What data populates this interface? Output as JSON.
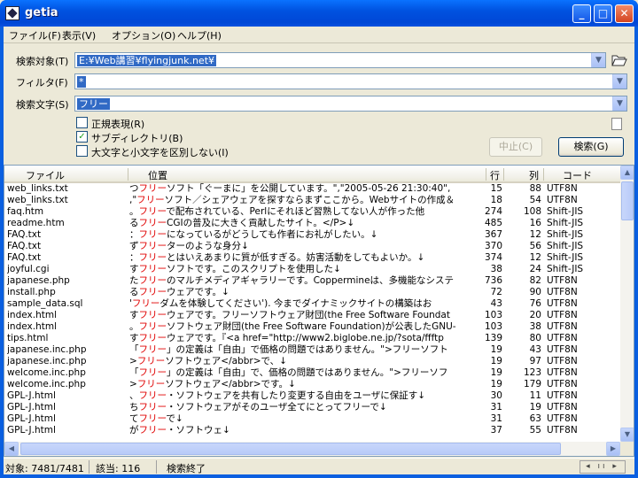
{
  "window": {
    "title": "getia",
    "min_glyph": "_",
    "max_glyph": "□",
    "close_glyph": "✕"
  },
  "menu": {
    "items": [
      "ファイル(F)",
      "表示(V)",
      "オプション(O)",
      "ヘルプ(H)"
    ]
  },
  "form": {
    "target_label": "検索対象(T)",
    "target_value": "E:¥Web講習¥flyingjunk.net¥",
    "filter_label": "フィルタ(F)",
    "filter_value": "*",
    "search_label": "検索文字(S)",
    "search_value": "フリー",
    "regex_label": "正規表現(R)",
    "regex_checked": false,
    "subdir_label": "サブディレクトリ(B)",
    "subdir_checked": true,
    "case_label": "大文字と小文字を区別しない(I)",
    "case_checked": false,
    "stop_label": "中止(C)",
    "search_button_label": "検索(G)"
  },
  "table": {
    "headers": {
      "file": "ファイル",
      "position": "位置",
      "line": "行",
      "col": "列",
      "code": "コード"
    },
    "rows": [
      {
        "file": "web_links.txt",
        "pre": "つ",
        "hit": "フリー",
        "post": "ソフト「ぐーまに」を公開しています。\",\"2005-05-26 21:30:40\",",
        "line": "15",
        "col": "88",
        "code": "UTF8N"
      },
      {
        "file": "web_links.txt",
        "pre": ",\"",
        "hit": "フリー",
        "post": "ソフト／シェアウェアを探すならまずここから。Webサイトの作成＆",
        "line": "18",
        "col": "54",
        "code": "UTF8N"
      },
      {
        "file": "faq.htm",
        "pre": "。",
        "hit": "フリー",
        "post": "で配布されている、Perlにそれほど習熟してない人が作った他",
        "line": "274",
        "col": "108",
        "code": "Shift-JIS"
      },
      {
        "file": "readme.htm",
        "pre": "る",
        "hit": "フリー",
        "post": "CGIの普及に大きく貢献したサイト。</P>↓",
        "line": "485",
        "col": "16",
        "code": "Shift-JIS"
      },
      {
        "file": "FAQ.txt",
        "pre": "：",
        "hit": "フリー",
        "post": "になっているがどうしても作者にお礼がしたい。↓",
        "line": "367",
        "col": "12",
        "code": "Shift-JIS"
      },
      {
        "file": "FAQ.txt",
        "pre": "ず",
        "hit": "フリー",
        "post": "ターのような身分↓",
        "line": "370",
        "col": "56",
        "code": "Shift-JIS"
      },
      {
        "file": "FAQ.txt",
        "pre": "：",
        "hit": "フリー",
        "post": "とはいえあまりに質が低すぎる。妨害活動をしてもよいか。↓",
        "line": "374",
        "col": "12",
        "code": "Shift-JIS"
      },
      {
        "file": "joyful.cgi",
        "pre": "す",
        "hit": "フリー",
        "post": "ソフトです。このスクリプトを使用した↓",
        "line": "38",
        "col": "24",
        "code": "Shift-JIS"
      },
      {
        "file": "japanese.php",
        "pre": "た",
        "hit": "フリー",
        "post": "のマルチメディアギャラリーです。Coppermineは、多機能なシステ",
        "line": "736",
        "col": "82",
        "code": "UTF8N"
      },
      {
        "file": "install.php",
        "pre": "る",
        "hit": "フリー",
        "post": "ウェアです。↓",
        "line": "72",
        "col": "90",
        "code": "UTF8N"
      },
      {
        "file": "sample_data.sql",
        "pre": "'",
        "hit": "フリー",
        "post": "ダムを体験してください'). 今までダイナミックサイトの構築はお",
        "line": "43",
        "col": "76",
        "code": "UTF8N"
      },
      {
        "file": "index.html",
        "pre": "す",
        "hit": "フリー",
        "post": "ウェアです。フリーソフトウェア財団(the Free Software Foundat",
        "line": "103",
        "col": "20",
        "code": "UTF8N"
      },
      {
        "file": "index.html",
        "pre": "。",
        "hit": "フリー",
        "post": "ソフトウェア財団(the Free Software Foundation)が公表したGNU-",
        "line": "103",
        "col": "38",
        "code": "UTF8N"
      },
      {
        "file": "tips.html",
        "pre": "す",
        "hit": "フリー",
        "post": "ウェアです。『<a href=\"http://www2.biglobe.ne.jp/?sota/ffftp",
        "line": "139",
        "col": "80",
        "code": "UTF8N"
      },
      {
        "file": "japanese.inc.php",
        "pre": "「",
        "hit": "フリー",
        "post": "」の定義は「自由」で価格の問題ではありません。\">フリーソフト",
        "line": "19",
        "col": "43",
        "code": "UTF8N"
      },
      {
        "file": "japanese.inc.php",
        "pre": ">",
        "hit": "フリー",
        "post": "ソフトウェア</abbr>で、↓",
        "line": "19",
        "col": "97",
        "code": "UTF8N"
      },
      {
        "file": "welcome.inc.php",
        "pre": "「",
        "hit": "フリー",
        "post": "」の定義は「自由」で、価格の問題ではありません。\">フリーソフ",
        "line": "19",
        "col": "123",
        "code": "UTF8N"
      },
      {
        "file": "welcome.inc.php",
        "pre": ">",
        "hit": "フリー",
        "post": "ソフトウェア</abbr>です。↓",
        "line": "19",
        "col": "179",
        "code": "UTF8N"
      },
      {
        "file": "GPL-J.html",
        "pre": "、",
        "hit": "フリー",
        "post": "・ソフトウェアを共有したり変更する自由をユーザに保証す↓",
        "line": "30",
        "col": "11",
        "code": "UTF8N"
      },
      {
        "file": "GPL-J.html",
        "pre": "ち",
        "hit": "フリー",
        "post": "・ソフトウェアがそのユーザ全てにとってフリーで↓",
        "line": "31",
        "col": "19",
        "code": "UTF8N"
      },
      {
        "file": "GPL-J.html",
        "pre": "て",
        "hit": "フリー",
        "post": "で↓",
        "line": "31",
        "col": "63",
        "code": "UTF8N"
      },
      {
        "file": "GPL-J.html",
        "pre": "が",
        "hit": "フリー",
        "post": "・ソフトウェ↓",
        "line": "37",
        "col": "55",
        "code": "UTF8N"
      }
    ]
  },
  "status": {
    "target": "対象: 7481/7481",
    "hits": "該当: 116",
    "state": "検索終了",
    "nav": "◂ ıı ▸"
  }
}
